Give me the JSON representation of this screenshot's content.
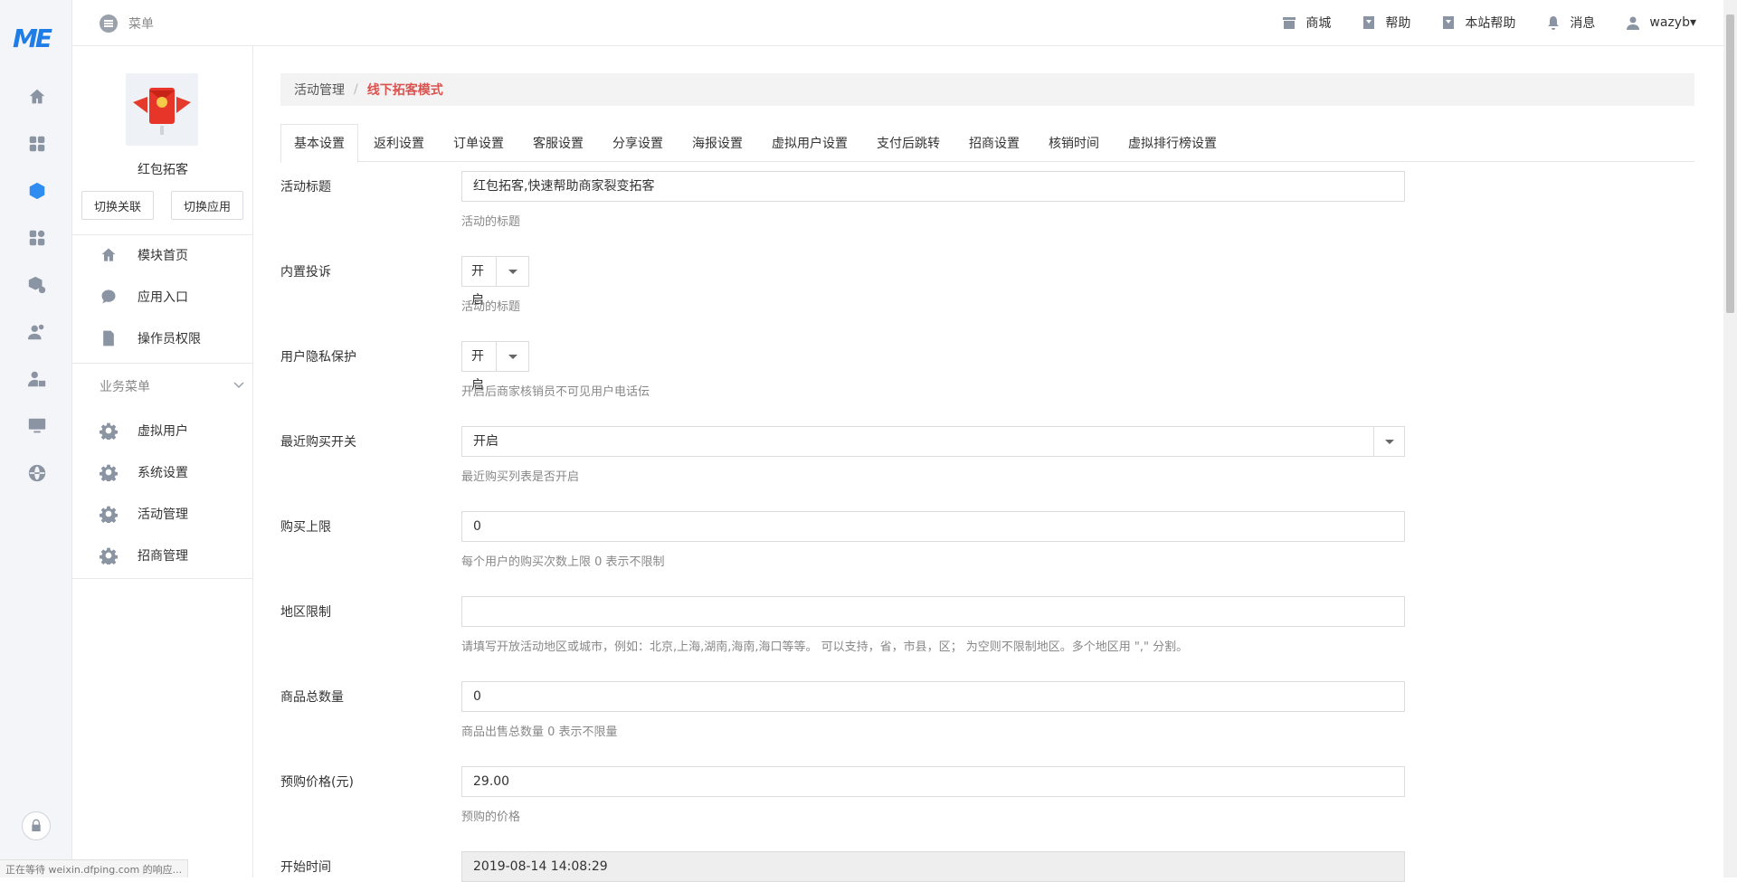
{
  "topbar": {
    "menu_label": "菜单",
    "items": [
      {
        "label": "商城",
        "icon": "store-icon"
      },
      {
        "label": "帮助",
        "icon": "help-icon"
      },
      {
        "label": "本站帮助",
        "icon": "site-help-icon"
      },
      {
        "label": "消息",
        "icon": "bell-icon"
      },
      {
        "label": "wazyb▾",
        "icon": "user-icon"
      }
    ]
  },
  "rail": {
    "logo": "ME",
    "icons": [
      "home-icon",
      "apps-icon",
      "cube-icon",
      "plugins-icon",
      "box-settings-icon",
      "users-icon",
      "user-lock-icon",
      "monitor-icon",
      "globe-icon"
    ],
    "active_index": 2
  },
  "sidebar": {
    "app_name": "红包拓客",
    "switch_link": "切换关联",
    "switch_app": "切换应用",
    "items": [
      {
        "label": "模块首页",
        "icon": "home-icon"
      },
      {
        "label": "应用入口",
        "icon": "chat-icon"
      },
      {
        "label": "操作员权限",
        "icon": "doc-edit-icon"
      }
    ],
    "group_label": "业务菜单",
    "group_items": [
      {
        "label": "虚拟用户",
        "icon": "gear-icon"
      },
      {
        "label": "系统设置",
        "icon": "gear-icon"
      },
      {
        "label": "活动管理",
        "icon": "gear-icon"
      },
      {
        "label": "招商管理",
        "icon": "gear-icon"
      }
    ]
  },
  "breadcrumb": {
    "parent": "活动管理",
    "separator": "/",
    "current": "线下拓客模式"
  },
  "tabs": [
    "基本设置",
    "返利设置",
    "订单设置",
    "客服设置",
    "分享设置",
    "海报设置",
    "虚拟用户设置",
    "支付后跳转",
    "招商设置",
    "核销时间",
    "虚拟排行榜设置"
  ],
  "form": {
    "title": {
      "label": "活动标题",
      "value": "红包拓客,快速帮助商家裂变拓客",
      "help": "活动的标题"
    },
    "complaint": {
      "label": "内置投诉",
      "value": "开启",
      "help": "活动的标题"
    },
    "privacy": {
      "label": "用户隐私保护",
      "value": "开启",
      "help": "开启后商家核销员不可见用户电话伝"
    },
    "recent_buy": {
      "label": "最近购买开关",
      "value": "开启",
      "help": "最近购买列表是否开启"
    },
    "buy_limit": {
      "label": "购买上限",
      "value": "0",
      "help": "每个用户的购买次数上限 0 表示不限制"
    },
    "region": {
      "label": "地区限制",
      "value": "",
      "help": "请填写开放活动地区或城市，例如：北京,上海,湖南,海南,海口等等。 可以支持，省，市县，区； 为空则不限制地区。多个地区用 \",\" 分割。"
    },
    "stock": {
      "label": "商品总数量",
      "value": "0",
      "help": "商品出售总数量 0 表示不限量"
    },
    "price": {
      "label": "预购价格(元)",
      "value": "29.00",
      "help": "预购的价格"
    },
    "start_time": {
      "label": "开始时间",
      "value": "2019-08-14 14:08:29"
    }
  },
  "status_bar": "正在等待 weixin.dfping.com 的响应..."
}
